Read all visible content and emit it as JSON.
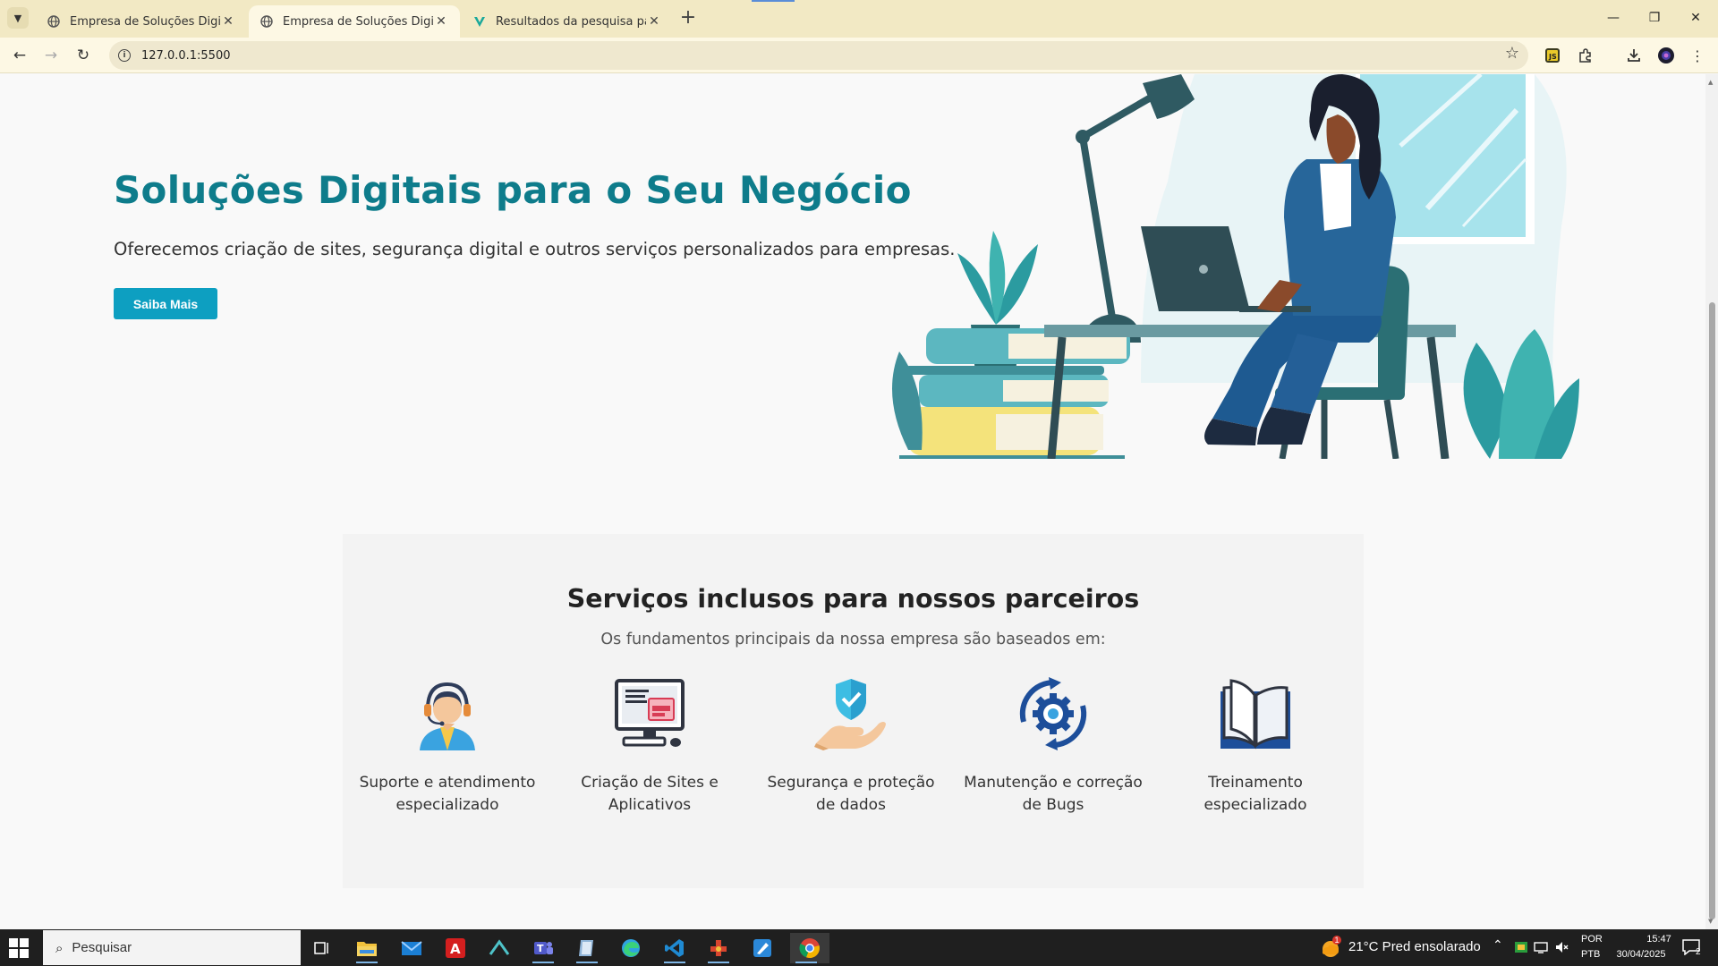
{
  "browser": {
    "tabs": [
      {
        "title": "Empresa de Soluções Digitais",
        "active": false
      },
      {
        "title": "Empresa de Soluções Digitais",
        "active": true
      },
      {
        "title": "Resultados da pesquisa para Liv",
        "active": false
      }
    ],
    "url": "127.0.0.1:5500"
  },
  "hero": {
    "title": "Soluções Digitais para o Seu Negócio",
    "subtitle": "Oferecemos criação de sites, segurança digital e outros serviços personalizados para empresas.",
    "button": "Saiba Mais"
  },
  "services": {
    "title": "Serviços inclusos para nossos parceiros",
    "subtitle": "Os fundamentos principais da nossa empresa são baseados em:",
    "items": [
      {
        "line1": "Suporte e atendimento",
        "line2": "especializado",
        "icon": "support-agent-icon"
      },
      {
        "line1": "Criação de Sites e",
        "line2": "Aplicativos",
        "icon": "computer-icon"
      },
      {
        "line1": "Segurança e proteção",
        "line2": "de dados",
        "icon": "shield-hand-icon"
      },
      {
        "line1": "Manutenção e correção",
        "line2": "de Bugs",
        "icon": "gear-refresh-icon"
      },
      {
        "line1": "Treinamento",
        "line2": "especializado",
        "icon": "open-book-icon"
      }
    ]
  },
  "taskbar": {
    "search_placeholder": "Pesquisar",
    "weather": "21°C  Pred ensolarado",
    "lang_line1": "POR",
    "lang_line2": "PTB",
    "time": "15:47",
    "date": "30/04/2025",
    "notifications": "2",
    "weather_badge": "1"
  },
  "colors": {
    "accent": "#0e7c8b",
    "button": "#0d9fc1",
    "tabbar": "#f2e9c4"
  }
}
